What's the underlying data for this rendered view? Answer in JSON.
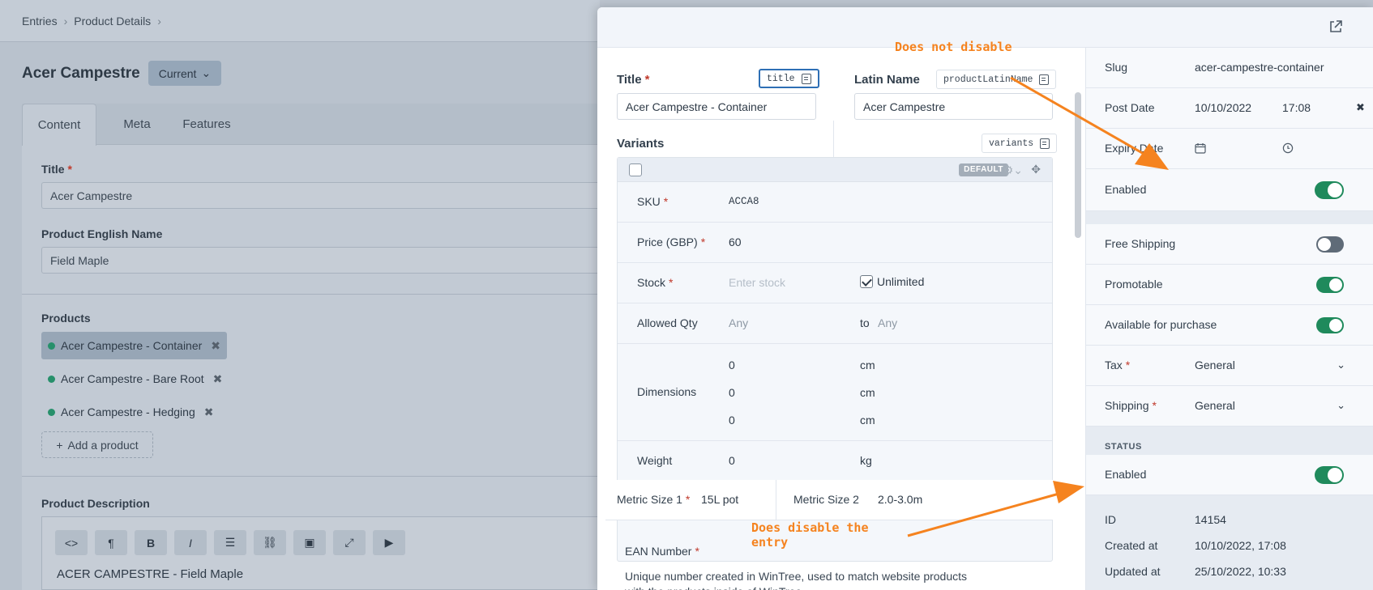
{
  "breadcrumbs": [
    "Entries",
    "Product Details"
  ],
  "page": {
    "title": "Acer Campestre",
    "revision": "Current"
  },
  "tabs": [
    "Content",
    "Meta",
    "Features"
  ],
  "bg_fields": {
    "title_label": "Title",
    "title_value": "Acer Campestre",
    "english_label": "Product English Name",
    "english_value": "Field Maple",
    "products_label": "Products",
    "products": [
      "Acer Campestre - Container",
      "Acer Campestre - Bare Root",
      "Acer Campestre - Hedging"
    ],
    "add_product": "Add a product",
    "description_label": "Product Description",
    "description_text": "ACER CAMPESTRE - Field Maple"
  },
  "panel": {
    "title_label": "Title",
    "title_handle": "title",
    "title_value": "Acer Campestre - Container",
    "latin_label": "Latin Name",
    "latin_handle": "productLatinName",
    "latin_value": "Acer Campestre",
    "variants_label": "Variants",
    "variants_handle": "variants",
    "default_badge": "DEFAULT",
    "variant": {
      "sku_label": "SKU",
      "sku_value": "ACCA8",
      "price_label": "Price (GBP)",
      "price_value": "60",
      "stock_label": "Stock",
      "stock_placeholder": "Enter stock",
      "unlimited_label": "Unlimited",
      "qty_label": "Allowed Qty",
      "qty_min": "Any",
      "qty_to": "to",
      "qty_max": "Any",
      "dimensions_label": "Dimensions",
      "dims": [
        "0",
        "0",
        "0"
      ],
      "dim_unit": "cm",
      "weight_label": "Weight",
      "weight_value": "0",
      "weight_unit": "kg"
    },
    "metric1_label": "Metric Size 1",
    "metric1_value": "15L pot",
    "metric2_label": "Metric Size 2",
    "metric2_value": "2.0-3.0m",
    "ean_label": "EAN Number",
    "ean_desc": "Unique number created in WinTree, used to match website products with the products inside of WinTree."
  },
  "sidebar": {
    "slug_label": "Slug",
    "slug_value": "acer-campestre-container",
    "post_date_label": "Post Date",
    "post_date": "10/10/2022",
    "post_time": "17:08",
    "expiry_label": "Expiry Date",
    "enabled_label": "Enabled",
    "free_shipping_label": "Free Shipping",
    "promotable_label": "Promotable",
    "available_label": "Available for purchase",
    "tax_label": "Tax",
    "tax_value": "General",
    "shipping_label": "Shipping",
    "shipping_value": "General",
    "status_heading": "STATUS",
    "status_enabled_label": "Enabled",
    "id_label": "ID",
    "id_value": "14154",
    "created_label": "Created at",
    "created_value": "10/10/2022, 17:08",
    "updated_label": "Updated at",
    "updated_value": "25/10/2022, 10:33"
  },
  "annotations": {
    "top": "Does not disable",
    "bottom_line1": "Does disable the",
    "bottom_line2": "entry"
  },
  "colors": {
    "accent_green": "#1f8a5c",
    "annotation_orange": "#f5831f",
    "focus_blue": "#2e6fb5"
  }
}
